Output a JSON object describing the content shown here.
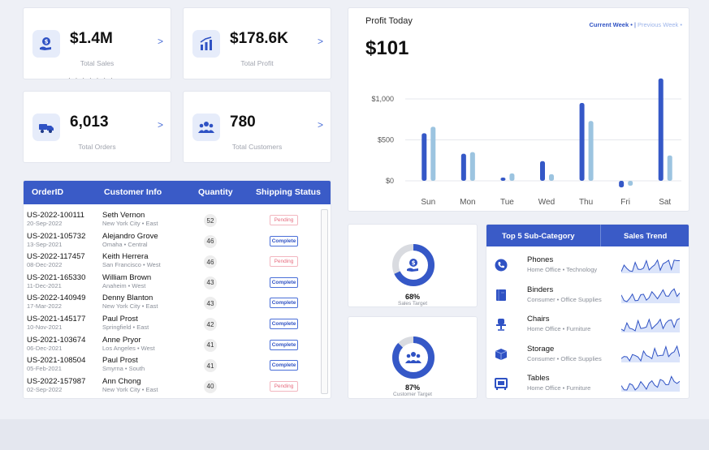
{
  "kpis": [
    {
      "value": "$1.4M",
      "label": "Total Sales",
      "icon": "hand-coin-icon"
    },
    {
      "value": "$178.6K",
      "label": "Total Profit",
      "icon": "bar-chart-icon"
    },
    {
      "value": "6,013",
      "label": "Total Orders",
      "icon": "delivery-icon"
    },
    {
      "value": "780",
      "label": "Total Customers",
      "icon": "people-icon"
    }
  ],
  "profit": {
    "title": "Profit Today",
    "value": "$101",
    "toggle_current": "Current Week •",
    "toggle_sep": " | ",
    "toggle_previous": "Previous Week •"
  },
  "chart_data": {
    "type": "bar",
    "categories": [
      "Sun",
      "Mon",
      "Tue",
      "Wed",
      "Thu",
      "Fri",
      "Sat"
    ],
    "series": [
      {
        "values": [
          580,
          330,
          40,
          240,
          950,
          -80,
          1250
        ],
        "color": "#3558c7"
      },
      {
        "values": [
          660,
          350,
          90,
          80,
          730,
          -60,
          310
        ],
        "color": "#9cc4e0"
      }
    ],
    "yticks": [
      "$0",
      "$500",
      "$1,000"
    ],
    "ylim": [
      -120,
      1300
    ]
  },
  "table": {
    "headers": [
      "OrderID",
      "Customer Info",
      "Quantity",
      "Shipping Status"
    ],
    "rows": [
      {
        "id": "US-2022-100111",
        "date": "20-Sep-2022",
        "name": "Seth Vernon",
        "loc": "New York City • East",
        "qty": "52",
        "status": "Pending"
      },
      {
        "id": "US-2021-105732",
        "date": "13-Sep-2021",
        "name": "Alejandro Grove",
        "loc": "Omaha • Central",
        "qty": "46",
        "status": "Complete"
      },
      {
        "id": "US-2022-117457",
        "date": "08-Dec-2022",
        "name": "Keith Herrera",
        "loc": "San Francisco • West",
        "qty": "46",
        "status": "Pending"
      },
      {
        "id": "US-2021-165330",
        "date": "11-Dec-2021",
        "name": "William Brown",
        "loc": "Anaheim • West",
        "qty": "43",
        "status": "Complete"
      },
      {
        "id": "US-2022-140949",
        "date": "17-Mar-2022",
        "name": "Denny Blanton",
        "loc": "New York City • East",
        "qty": "43",
        "status": "Complete"
      },
      {
        "id": "US-2021-145177",
        "date": "10-Nov-2021",
        "name": "Paul Prost",
        "loc": "Springfield • East",
        "qty": "42",
        "status": "Complete"
      },
      {
        "id": "US-2021-103674",
        "date": "06-Dec-2021",
        "name": "Anne Pryor",
        "loc": "Los Angeles • West",
        "qty": "41",
        "status": "Complete"
      },
      {
        "id": "US-2021-108504",
        "date": "05-Feb-2021",
        "name": "Paul Prost",
        "loc": "Smyrna • South",
        "qty": "41",
        "status": "Complete"
      },
      {
        "id": "US-2022-157987",
        "date": "02-Sep-2022",
        "name": "Ann Chong",
        "loc": "New York City • East",
        "qty": "40",
        "status": "Pending"
      }
    ]
  },
  "targets": [
    {
      "pct": "68%",
      "label": "Sales Target",
      "fraction": 0.68,
      "icon": "hand-coin-icon"
    },
    {
      "pct": "87%",
      "label": "Customer Target",
      "fraction": 0.87,
      "icon": "people-icon"
    }
  ],
  "subcat": {
    "header_left": "Top 5 Sub-Category",
    "header_right": "Sales Trend",
    "items": [
      {
        "name": "Phones",
        "desc": "Home Office • Technology",
        "icon": "phone-icon"
      },
      {
        "name": "Binders",
        "desc": "Consumer • Office Supplies",
        "icon": "binder-icon"
      },
      {
        "name": "Chairs",
        "desc": "Home Office • Furniture",
        "icon": "chair-icon"
      },
      {
        "name": "Storage",
        "desc": "Consumer • Office Supplies",
        "icon": "box-icon"
      },
      {
        "name": "Tables",
        "desc": "Home Office • Furniture",
        "icon": "table-icon"
      }
    ]
  },
  "colors": {
    "accent": "#3a5bc7",
    "bar_dark": "#3558c7",
    "bar_light": "#9cc4e0",
    "pending": "#e66b7e"
  }
}
